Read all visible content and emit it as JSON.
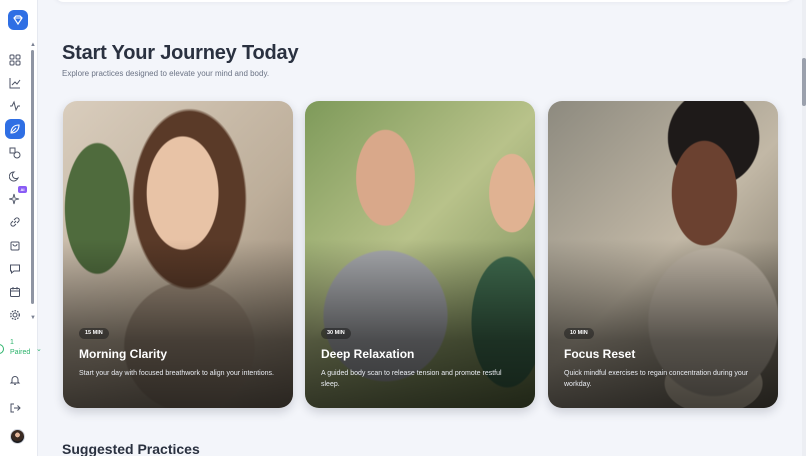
{
  "sidebar": {
    "paired_count": "1",
    "paired_label": "Paired",
    "ai_badge": "AI",
    "icons": [
      "app-logo-icon",
      "dashboard-icon",
      "chart-icon",
      "activity-icon",
      "leaf-icon",
      "shapes-icon",
      "moon-icon",
      "sparkles-icon",
      "link-icon",
      "bag-icon",
      "chat-icon",
      "calendar-icon",
      "settings-icon",
      "bell-icon",
      "logout-icon"
    ]
  },
  "header": {
    "title": "Start Your Journey Today",
    "subtitle": "Explore practices designed to elevate your mind and body."
  },
  "cards": [
    {
      "duration": "15 MIN",
      "title": "Morning Clarity",
      "description": "Start your day with focused breathwork to align your intentions."
    },
    {
      "duration": "30 MIN",
      "title": "Deep Relaxation",
      "description": "A guided body scan to release tension and promote restful sleep."
    },
    {
      "duration": "10 MIN",
      "title": "Focus Reset",
      "description": "Quick mindful exercises to regain concentration during your workday."
    }
  ],
  "sections": {
    "suggested_title": "Suggested Practices"
  },
  "colors": {
    "accent": "#2f6fe4",
    "paired_green": "#2cb36b",
    "ai_purple": "#8a5cf5"
  }
}
